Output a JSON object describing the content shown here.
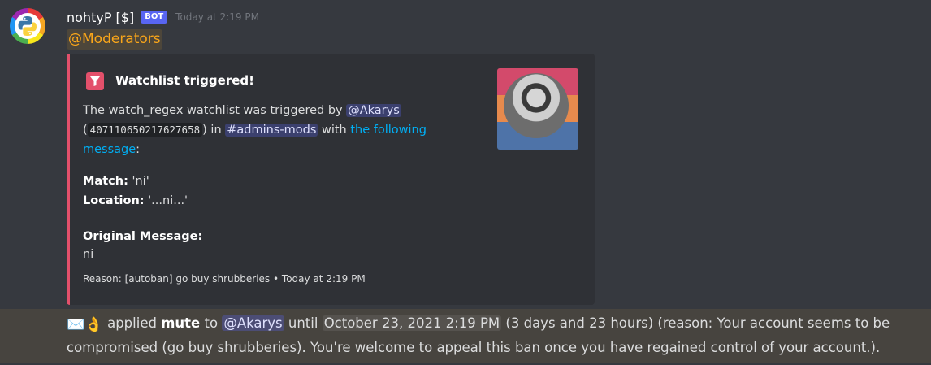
{
  "message": {
    "author": "nohtyP [$]",
    "bot_tag": "BOT",
    "timestamp": "Today at 2:19 PM",
    "role_mention": "@Moderators"
  },
  "embed": {
    "title": "Watchlist triggered!",
    "desc_prefix": "The watch_regex watchlist was triggered by",
    "user_mention": "@Akarys",
    "user_id": "407110650217627658",
    "in_text": "in",
    "channel_mention": "#admins-mods",
    "with_text": "with",
    "link_text": "the following message",
    "colon": ":",
    "match_label": "Match:",
    "match_value": "'ni'",
    "location_label": "Location:",
    "location_value": "'...ni...'",
    "original_label": "Original Message:",
    "original_value": "ni",
    "footer_reason": "Reason: [autoban] go buy shrubberies",
    "footer_time": "Today at 2:19 PM"
  },
  "system": {
    "applied": "applied",
    "action": "mute",
    "to": "to",
    "target": "@Akarys",
    "until": "until",
    "date": "October 23, 2021 2:19 PM",
    "rest": "(3 days and 23 hours) (reason: Your account seems to be compromised (go buy shrubberies). You're welcome to appeal this ban once you have regained control of your account.)."
  },
  "colors": {
    "background": "#36393f",
    "embed_border": "#e3506b",
    "highlight": "#47443f",
    "link": "#00aff4",
    "role_mention": "#faa61a"
  }
}
